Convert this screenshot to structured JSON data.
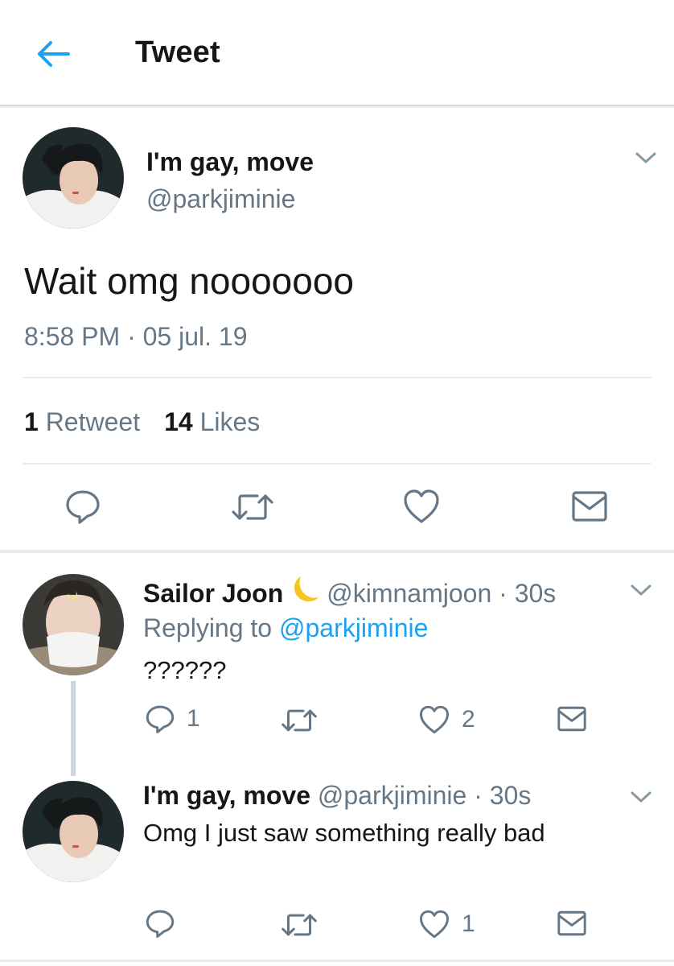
{
  "header": {
    "title": "Tweet"
  },
  "main_tweet": {
    "display_name": "I'm gay, move",
    "handle": "@parkjiminie",
    "text": "Wait omg nooooooo",
    "timestamp": "8:58 PM · 05 jul. 19",
    "retweet_count": "1",
    "retweet_label": "Retweet",
    "like_count": "14",
    "like_label": "Likes"
  },
  "replies": [
    {
      "display_name": "Sailor Joon",
      "emoji": "crescent-moon",
      "handle_time": "@kimnamjoon · 30s",
      "replying_prefix": "Replying to",
      "replying_to": "@parkjiminie",
      "text": "??????",
      "reply_count": "1",
      "retweet_count": "",
      "like_count": "2"
    },
    {
      "display_name": "I'm gay, move",
      "handle_time": "@parkjiminie · 30s",
      "text": "Omg I just saw something really bad",
      "reply_count": "",
      "retweet_count": "",
      "like_count": "1"
    }
  ],
  "icons": {
    "back": "arrow-left-icon",
    "caret": "chevron-down-icon",
    "reply": "speech-bubble-icon",
    "retweet": "retweet-icon",
    "like": "heart-icon",
    "share": "envelope-icon"
  },
  "colors": {
    "accent": "#1da1f2",
    "text_primary": "#14171a",
    "text_secondary": "#657786",
    "divider": "#e6ecf0"
  }
}
